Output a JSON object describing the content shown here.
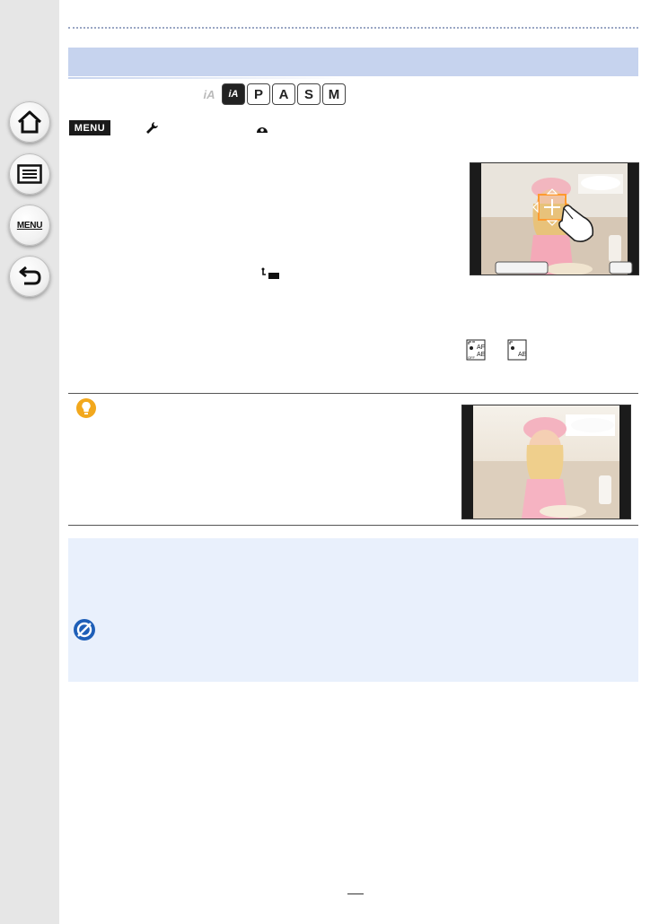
{
  "sidebar": {
    "buttons": [
      {
        "name": "home",
        "icon": "home-icon"
      },
      {
        "name": "contents",
        "icon": "list-icon"
      },
      {
        "name": "menu",
        "icon": "menu-icon",
        "label": "MENU"
      },
      {
        "name": "back",
        "icon": "back-arrow-icon"
      }
    ]
  },
  "mode_icons": {
    "ia": "iA",
    "ia_plus": "iA",
    "p": "P",
    "a": "A",
    "s": "S",
    "m": "M"
  },
  "menu_path": {
    "badge": "MENU",
    "icons": [
      "wrench-icon",
      "dome-icon"
    ]
  },
  "af_icons": {
    "first_top": "AF",
    "first_bottom": "AE",
    "second": "AE",
    "off": "OFF"
  },
  "colors": {
    "section_bar": "#c6d3ee",
    "note_box": "#e9f0fc",
    "tip_icon": "#f2a81d",
    "note_icon": "#1f5fb8"
  }
}
